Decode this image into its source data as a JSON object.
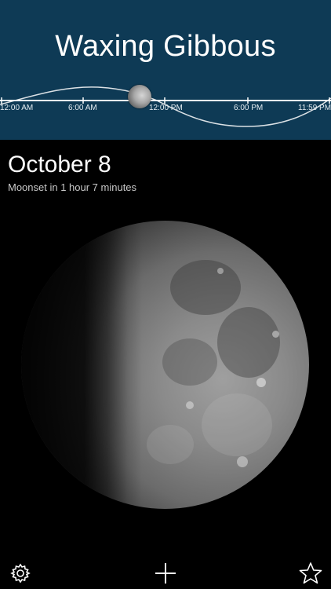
{
  "header": {
    "phase_name": "Waxing Gibbous",
    "background_color": "#0e3a55"
  },
  "timeline": {
    "tick_labels": [
      "12:00 AM",
      "6:00 AM",
      "12:00 PM",
      "6:00 PM",
      "11:59 PM"
    ],
    "current_moon_icon": "moon-position-icon"
  },
  "date_info": {
    "date": "October 8",
    "moonset_text": "Moonset in 1 hour 7 minutes"
  },
  "moon": {
    "icon": "moon-phase-image"
  },
  "toolbar": {
    "settings_icon": "gear-icon",
    "add_icon": "plus-icon",
    "favorite_icon": "star-icon"
  }
}
